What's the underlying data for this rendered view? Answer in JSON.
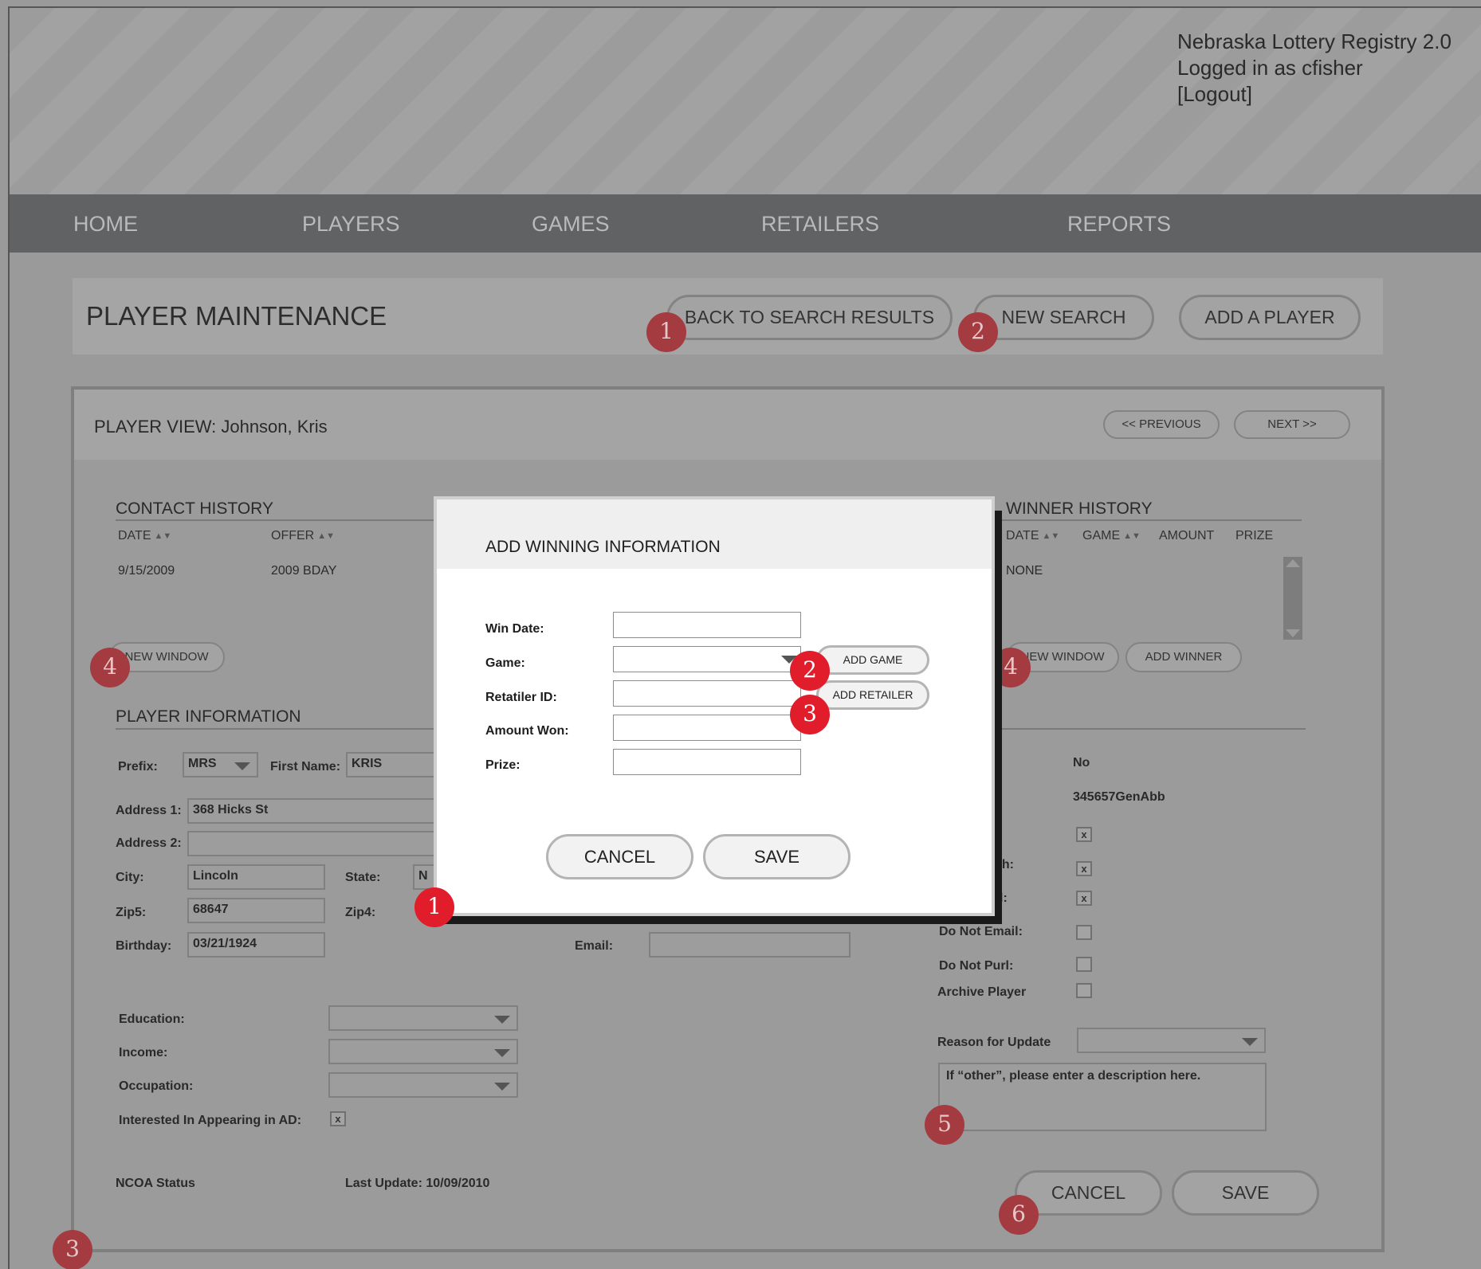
{
  "header": {
    "app_title": "Nebraska Lottery Registry 2.0",
    "user": "Logged in as cfisher",
    "logout": "[Logout]"
  },
  "nav": {
    "home": "HOME",
    "players": "PLAYERS",
    "games": "GAMES",
    "retailers": "RETAILERS",
    "reports": "REPORTS"
  },
  "toolbar": {
    "title": "PLAYER MAINTENANCE",
    "back": "BACK TO SEARCH RESULTS",
    "new_search": "NEW SEARCH",
    "add_player": "ADD A PLAYER"
  },
  "player_view": {
    "title": "PLAYER VIEW: Johnson, Kris",
    "previous": "<< PREVIOUS",
    "next": "NEXT >>"
  },
  "contact_history": {
    "title": "CONTACT HISTORY",
    "columns": [
      "DATE",
      "OFFER"
    ],
    "rows": [
      [
        "9/15/2009",
        "2009 BDAY"
      ]
    ],
    "new_window": "NEW WINDOW"
  },
  "winner_history": {
    "title": "WINNER HISTORY",
    "columns": [
      "DATE",
      "GAME",
      "AMOUNT",
      "PRIZE"
    ],
    "empty": "NONE",
    "new_window": "NEW WINDOW",
    "add_winner": "ADD WINNER"
  },
  "player_info": {
    "title": "PLAYER INFORMATION",
    "prefix_label": "Prefix:",
    "prefix_value": "MRS",
    "first_name_label": "First Name:",
    "first_name_value": "KRIS",
    "address1_label": "Address 1:",
    "address1_value": "368 Hicks St",
    "address2_label": "Address 2:",
    "address2_value": "",
    "city_label": "City:",
    "city_value": "Lincoln",
    "state_label": "State:",
    "state_value": "N",
    "zip5_label": "Zip5:",
    "zip5_value": "68647",
    "zip4_label": "Zip4:",
    "birthday_label": "Birthday:",
    "birthday_value": "03/21/1924",
    "email_label": "Email:",
    "education_label": "Education:",
    "income_label": "Income:",
    "occupation_label": "Occupation:",
    "interested_label": "Interested In Appearing in AD:",
    "interested_checked": "x",
    "ncoa_label": "NCOA Status",
    "last_update": "Last Update: 10/09/2010"
  },
  "right_col": {
    "no_value": "No",
    "id_value": "345657GenAbb",
    "partial_1": "ch:",
    "partial_2": "l:",
    "check_x": "x",
    "do_not_email": "Do Not Email:",
    "do_not_purl": "Do Not Purl:",
    "archive": "Archive Player",
    "reason_label": "Reason for Update",
    "reason_placeholder": "If “other”, please enter a description here.",
    "cancel": "CANCEL",
    "save": "SAVE"
  },
  "modal": {
    "title": "ADD WINNING INFORMATION",
    "win_date_label": "Win Date:",
    "game_label": "Game:",
    "retailer_label": "Retatiler ID:",
    "amount_label": "Amount Won:",
    "prize_label": "Prize:",
    "add_game": "ADD GAME",
    "add_retailer": "ADD RETAILER",
    "cancel": "CANCEL",
    "save": "SAVE"
  },
  "annotations": {
    "n1": "1",
    "n2": "2",
    "n3": "3",
    "n4": "4",
    "n5": "5",
    "n6": "6"
  },
  "colors": {
    "nav_bg": "#616264",
    "badge_muted": "#a33b41",
    "badge_bright": "#e11d2b",
    "modal_bg": "#ffffff"
  }
}
